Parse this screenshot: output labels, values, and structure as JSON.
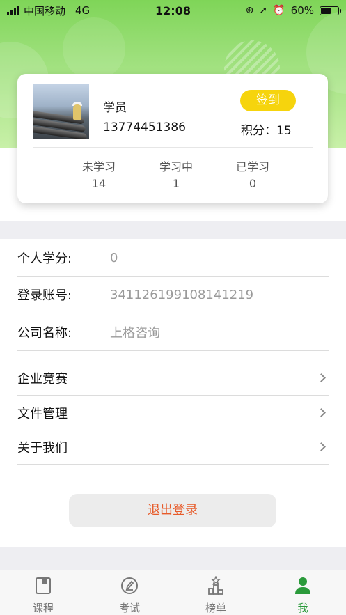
{
  "status_bar": {
    "carrier": "中国移动",
    "network": "4G",
    "time": "12:08",
    "battery": "60%",
    "battery_level": 0.6
  },
  "profile": {
    "avatar_desc": "pipeline-worker-photo",
    "role": "学员",
    "phone": "13774451386",
    "checkin_label": "签到",
    "points_label": "积分：",
    "points_value": "15",
    "stats": [
      {
        "label": "未学习",
        "value": "14"
      },
      {
        "label": "学习中",
        "value": "1"
      },
      {
        "label": "已学习",
        "value": "0"
      }
    ]
  },
  "info": [
    {
      "label": "个人学分:",
      "value": "0"
    },
    {
      "label": "登录账号:",
      "value": "341126199108141219"
    },
    {
      "label": "公司名称:",
      "value": "上格咨询"
    }
  ],
  "menu": [
    {
      "label": "企业竞赛"
    },
    {
      "label": "文件管理"
    },
    {
      "label": "关于我们"
    }
  ],
  "logout_label": "退出登录",
  "tabs": [
    {
      "label": "课程",
      "icon": "book-icon",
      "active": false
    },
    {
      "label": "考试",
      "icon": "pencil-circle-icon",
      "active": false
    },
    {
      "label": "榜单",
      "icon": "podium-star-icon",
      "active": false
    },
    {
      "label": "我",
      "icon": "person-icon",
      "active": true
    }
  ],
  "colors": {
    "header_green": "#7fd558",
    "checkin_yellow": "#f6d40d",
    "logout_text": "#e75b2a",
    "tab_active": "#2a9a3a"
  }
}
